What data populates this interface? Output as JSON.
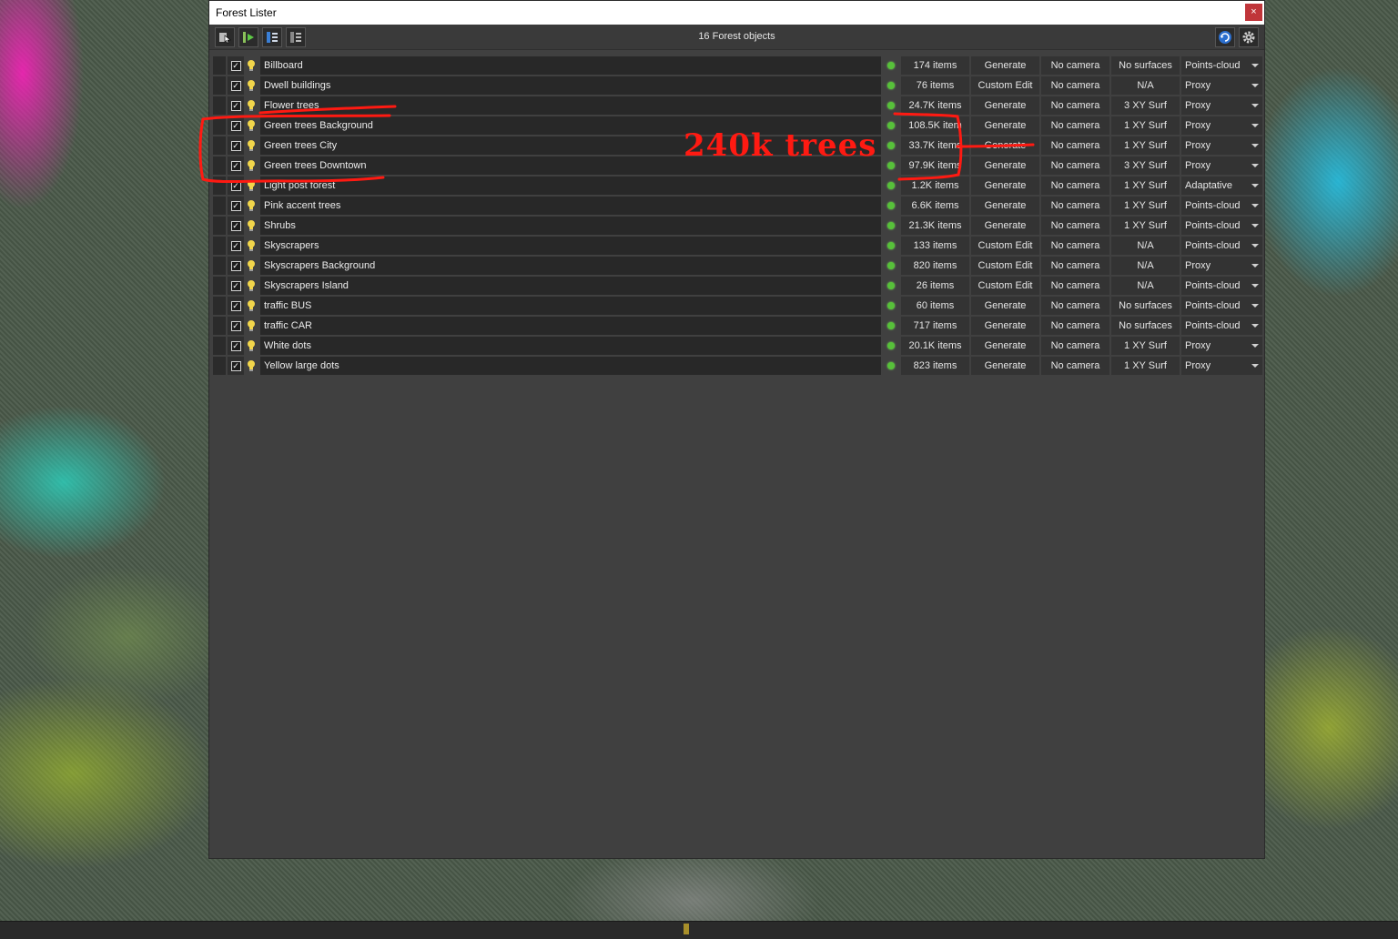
{
  "window": {
    "title": "Forest Lister",
    "close_symbol": "×"
  },
  "toolbar": {
    "object_count": "16 Forest objects",
    "left_icons": [
      "cursor-select-icon",
      "add-forest-icon",
      "list-view-icon",
      "columns-view-icon"
    ],
    "right_icons": [
      "refresh-icon",
      "settings-icon"
    ]
  },
  "rows": [
    {
      "name": "Billboard",
      "items": "174 items",
      "mode": "Generate",
      "camera": "No camera",
      "surface": "No surfaces",
      "display": "Points-cloud"
    },
    {
      "name": "Dwell buildings",
      "items": "76 items",
      "mode": "Custom Edit",
      "camera": "No camera",
      "surface": "N/A",
      "display": "Proxy"
    },
    {
      "name": "Flower trees",
      "items": "24.7K items",
      "mode": "Generate",
      "camera": "No camera",
      "surface": "3 XY Surf",
      "display": "Proxy"
    },
    {
      "name": "Green trees Background",
      "items": "108.5K item",
      "mode": "Generate",
      "camera": "No camera",
      "surface": "1 XY Surf",
      "display": "Proxy"
    },
    {
      "name": "Green trees City",
      "items": "33.7K items",
      "mode": "Generate",
      "camera": "No camera",
      "surface": "1 XY Surf",
      "display": "Proxy"
    },
    {
      "name": "Green trees Downtown",
      "items": "97.9K items",
      "mode": "Generate",
      "camera": "No camera",
      "surface": "3 XY Surf",
      "display": "Proxy"
    },
    {
      "name": "Light post forest",
      "items": "1.2K items",
      "mode": "Generate",
      "camera": "No camera",
      "surface": "1 XY Surf",
      "display": "Adaptative"
    },
    {
      "name": "Pink accent trees",
      "items": "6.6K items",
      "mode": "Generate",
      "camera": "No camera",
      "surface": "1 XY Surf",
      "display": "Points-cloud"
    },
    {
      "name": "Shrubs",
      "items": "21.3K items",
      "mode": "Generate",
      "camera": "No camera",
      "surface": "1 XY Surf",
      "display": "Points-cloud"
    },
    {
      "name": "Skyscrapers",
      "items": "133 items",
      "mode": "Custom Edit",
      "camera": "No camera",
      "surface": "N/A",
      "display": "Points-cloud"
    },
    {
      "name": "Skyscrapers Background",
      "items": "820 items",
      "mode": "Custom Edit",
      "camera": "No camera",
      "surface": "N/A",
      "display": "Proxy"
    },
    {
      "name": "Skyscrapers Island",
      "items": "26 items",
      "mode": "Custom Edit",
      "camera": "No camera",
      "surface": "N/A",
      "display": "Points-cloud"
    },
    {
      "name": "traffic BUS",
      "items": "60 items",
      "mode": "Generate",
      "camera": "No camera",
      "surface": "No surfaces",
      "display": "Points-cloud"
    },
    {
      "name": "traffic CAR",
      "items": "717 items",
      "mode": "Generate",
      "camera": "No camera",
      "surface": "No surfaces",
      "display": "Points-cloud"
    },
    {
      "name": "White dots",
      "items": "20.1K items",
      "mode": "Generate",
      "camera": "No camera",
      "surface": "1 XY Surf",
      "display": "Proxy"
    },
    {
      "name": "Yellow large dots",
      "items": "823 items",
      "mode": "Generate",
      "camera": "No camera",
      "surface": "1 XY Surf",
      "display": "Proxy"
    }
  ],
  "annotation": {
    "text": "240k trees",
    "color": "#ff1a12"
  },
  "colors": {
    "status_dot": "#57c13a",
    "bulb": "#f2d64b",
    "close_button": "#c0353a"
  }
}
